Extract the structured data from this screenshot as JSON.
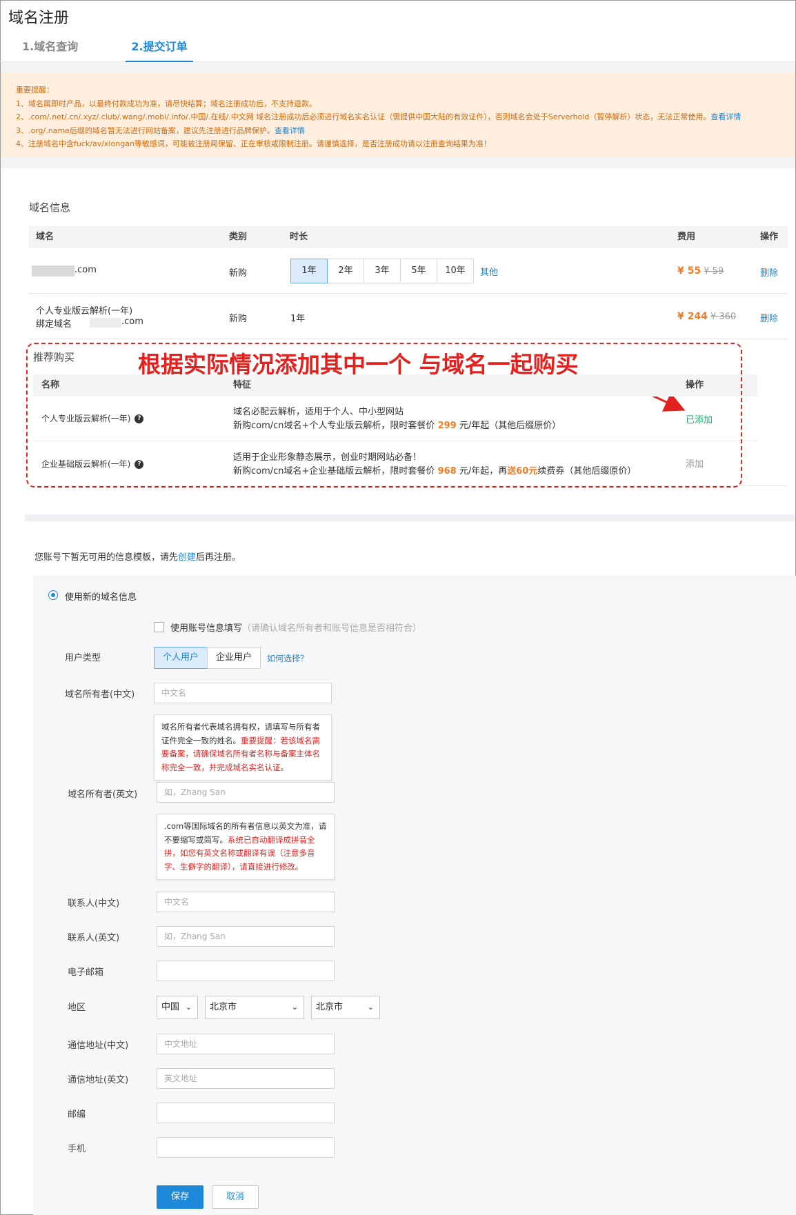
{
  "page": {
    "title": "域名注册"
  },
  "tabs": [
    {
      "label": "1.域名查询"
    },
    {
      "label": "2.提交订单"
    }
  ],
  "notice": {
    "title": "重要提醒：",
    "line1": "1、域名属即时产品，以最终付款成功为准，请尽快结算；域名注册成功后，不支持退款。",
    "line2": "2、.com/.net/.cn/.xyz/.club/.wang/.mobi/.info/.中国/.在线/.中文网 域名注册成功后必须进行域名实名认证（需提供中国大陆的有效证件），否则域名会处于Serverhold（暂停解析）状态，无法正常使用。",
    "line2_link": "查看详情",
    "line3": "3、.org/.name后缀的域名暂无法进行网站备案，建议先注册进行品牌保护。",
    "line3_link": "查看详情",
    "line4": "4、注册域名中含fuck/av/xiongan等敏感词，可能被注册局保留、正在审核或限制注册。请谨慎选择，是否注册成功请以注册查询结果为准！"
  },
  "domain_info": {
    "title": "域名信息",
    "headers": {
      "domain": "域名",
      "type": "类别",
      "duration": "时长",
      "cost": "费用",
      "action": "操作"
    },
    "row1": {
      "domain": ".com",
      "type": "新购",
      "durations": [
        "1年",
        "2年",
        "3年",
        "5年",
        "10年"
      ],
      "selected": "1年",
      "other": "其他",
      "price": "¥ 55",
      "old_price": "¥ 59",
      "action": "删除"
    },
    "row2": {
      "name": "个人专业版云解析(一年)",
      "bind_label": "绑定域名",
      "bind_suffix": ".com",
      "type": "新购",
      "duration": "1年",
      "price": "¥ 244",
      "old_price": "¥ 360",
      "action": "删除"
    }
  },
  "recommend": {
    "title": "推荐购买",
    "annotation": "根据实际情况添加其中一个 与域名一起购买",
    "headers": {
      "name": "名称",
      "feature": "特征",
      "action": "操作"
    },
    "item1": {
      "name": "个人专业版云解析(一年)",
      "feat_line1": "域名必配云解析，适用于个人、中小型网站",
      "feat_line2_pre": "新购com/cn域名+个人专业版云解析，限时套餐价",
      "price": "299",
      "feat_line2_post": "元/年起（其他后缀原价）",
      "action": "已添加"
    },
    "item2": {
      "name": "企业基础版云解析(一年)",
      "feat_line1": "适用于企业形象静态展示，创业时期网站必备！",
      "feat_line2_pre": "新购com/cn域名+企业基础版云解析，限时套餐价",
      "price": "968",
      "feat_line2_mid": "元/年起，再",
      "gift": "送60元",
      "feat_line2_post": "续费券（其他后缀原价）",
      "action": "添加"
    }
  },
  "template_notice": {
    "pre": "您账号下暂无可用的信息模板，请先",
    "link": "创建",
    "post": "后再注册。"
  },
  "form": {
    "radio_label": "使用新的域名信息",
    "checkbox_label": "使用账号信息填写",
    "checkbox_hint": "（请确认域名所有者和账号信息是否相符合）",
    "user_type_label": "用户类型",
    "user_types": [
      "个人用户",
      "企业用户"
    ],
    "user_type_help": "如何选择？",
    "owner_cn_label": "域名所有者(中文)",
    "owner_cn_placeholder": "中文名",
    "owner_cn_tip_pre": "域名所有者代表域名拥有权，请填写与所有者证件完全一致的姓名。",
    "owner_cn_tip_red": "重要提醒：若该域名需要备案，请确保域名所有者名称与备案主体名称完全一致，并完成域名实名认证。",
    "owner_en_label": "域名所有者(英文)",
    "owner_en_placeholder": "如，Zhang San",
    "owner_en_tip_pre": ".com等国际域名的所有者信息以英文为准，请不要缩写或简写。",
    "owner_en_tip_red": "系统已自动翻译成拼音全拼，如您有英文名称或翻译有误（注意多音字、生僻字的翻译），请直接进行修改。",
    "contact_cn_label": "联系人(中文)",
    "contact_cn_placeholder": "中文名",
    "contact_en_label": "联系人(英文)",
    "contact_en_placeholder": "如，Zhang San",
    "email_label": "电子邮箱",
    "region_label": "地区",
    "region_country": "中国",
    "region_province": "北京市",
    "region_city": "北京市",
    "addr_cn_label": "通信地址(中文)",
    "addr_cn_placeholder": "中文地址",
    "addr_en_label": "通信地址(英文)",
    "addr_en_placeholder": "英文地址",
    "zip_label": "邮编",
    "phone_label": "手机",
    "save": "保存",
    "cancel": "取消"
  },
  "colors": {
    "accent": "#1d87d8",
    "warning": "#d3690c",
    "price": "#f47b20",
    "annotation": "#e3221f",
    "added": "#17b26a"
  }
}
